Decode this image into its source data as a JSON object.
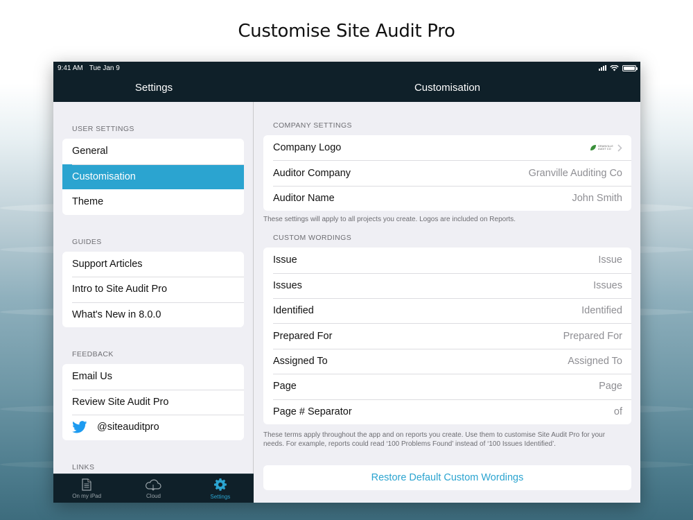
{
  "headline": "Customise Site Audit Pro",
  "status_bar": {
    "time": "9:41 AM",
    "date": "Tue Jan 9"
  },
  "sidebar": {
    "title": "Settings",
    "sections": {
      "user_settings": {
        "header": "USER SETTINGS",
        "items": [
          "General",
          "Customisation",
          "Theme"
        ]
      },
      "guides": {
        "header": "GUIDES",
        "items": [
          "Support Articles",
          "Intro to Site Audit Pro",
          "What's New in 8.0.0"
        ]
      },
      "feedback": {
        "header": "FEEDBACK",
        "items": [
          "Email Us",
          "Review Site Audit Pro",
          "@siteauditpro"
        ]
      },
      "links": {
        "header": "LINKS"
      }
    },
    "selected": "Customisation"
  },
  "tabbar": {
    "tabs": [
      {
        "label": "On my iPad",
        "icon": "document-icon"
      },
      {
        "label": "Cloud",
        "icon": "cloud-icon"
      },
      {
        "label": "Settings",
        "icon": "gear-icon"
      }
    ],
    "active": "Settings"
  },
  "detail": {
    "title": "Customisation",
    "company_settings": {
      "header": "COMPANY SETTINGS",
      "logo_label": "Company Logo",
      "logo_text": "GRANVILLE AUDIT CO",
      "auditor_company_label": "Auditor Company",
      "auditor_company_value": "Granville Auditing Co",
      "auditor_name_label": "Auditor Name",
      "auditor_name_value": "John Smith",
      "footer": "These settings will apply to all projects you create. Logos are included on Reports."
    },
    "custom_wordings": {
      "header": "CUSTOM WORDINGS",
      "rows": [
        {
          "label": "Issue",
          "value": "Issue"
        },
        {
          "label": "Issues",
          "value": "Issues"
        },
        {
          "label": "Identified",
          "value": "Identified"
        },
        {
          "label": "Prepared For",
          "value": "Prepared For"
        },
        {
          "label": "Assigned To",
          "value": "Assigned To"
        },
        {
          "label": "Page",
          "value": "Page"
        },
        {
          "label": "Page # Separator",
          "value": "of"
        }
      ],
      "footer": "These terms apply throughout the app and on reports you create. Use them to customise Site Audit Pro for your needs. For example, reports could read ‘100 Problems Found’ instead of ‘100 Issues Identified’."
    },
    "restore_button": "Restore Default Custom Wordings"
  },
  "colors": {
    "accent": "#2ba4d0",
    "navbar": "#0f2029",
    "twitter": "#1d9bf0",
    "logo_green": "#3a8f3a"
  }
}
